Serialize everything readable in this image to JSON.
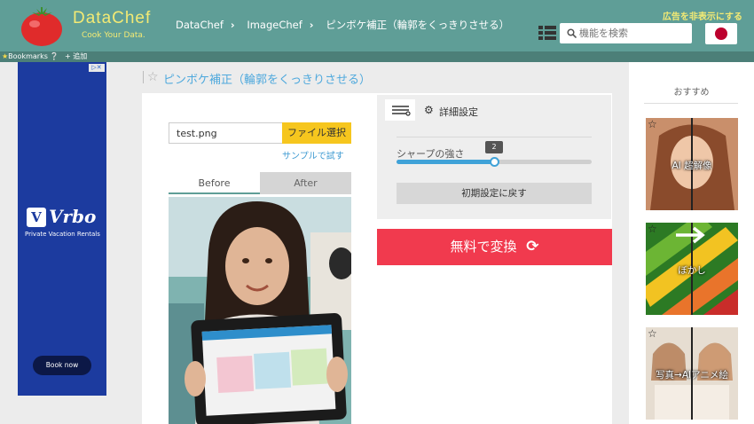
{
  "header": {
    "brand": "DataChef",
    "tagline": "Cook Your Data.",
    "breadcrumbs": [
      "DataChef",
      "ImageChef",
      "ピンボケ補正（輪郭をくっきりさせる）"
    ],
    "hide_ads": "広告を非表示にする",
    "search_placeholder": "機能を検索"
  },
  "bookmarks": {
    "bookmarks_label": "Bookmarks",
    "add_label": "追加"
  },
  "ad": {
    "brand": "Vrbo",
    "subtitle": "Private Vacation Rentals",
    "cta": "Book now"
  },
  "page": {
    "title": "ピンボケ補正（輪郭をくっきりさせる）"
  },
  "file": {
    "filename": "test.png",
    "choose_label": "ファイル選択",
    "sample_label": "サンプルで試す"
  },
  "tabs": {
    "before": "Before",
    "after": "After"
  },
  "settings": {
    "label": "詳細設定",
    "sharpness_label": "シャープの強さ",
    "sharpness_value": "2",
    "sharpness_fraction": 0.5,
    "reset_label": "初期設定に戻す"
  },
  "convert": {
    "label": "無料で変換"
  },
  "sidebar": {
    "title": "おすすめ",
    "items": [
      {
        "label": "AI 超解像"
      },
      {
        "label": "ぼかし"
      },
      {
        "label": "写真→AIアニメ絵"
      }
    ]
  },
  "colors": {
    "header_bg": "#5f9e97",
    "accent_yellow": "#f6c61e",
    "convert_red": "#f13a4e",
    "slider_blue": "#3fa2d8"
  }
}
